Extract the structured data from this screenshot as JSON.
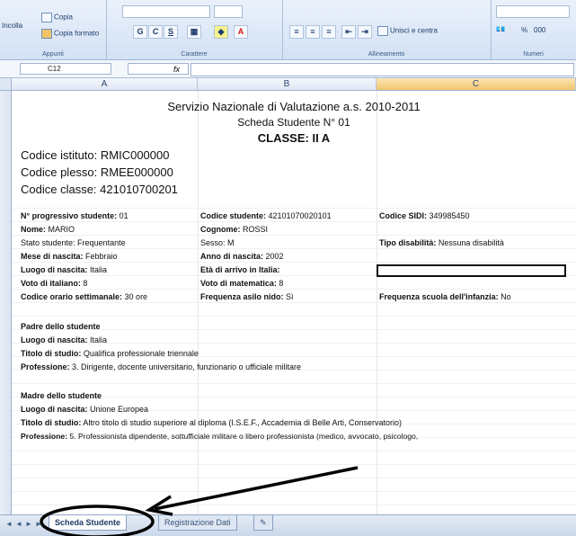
{
  "ribbon": {
    "clipboard": {
      "paste": "Incolla",
      "copy": "Copia",
      "format_painter": "Copia formato",
      "group": "Appunti"
    },
    "font": {
      "bold": "G",
      "italic": "C",
      "underline": "S",
      "group": "Carattere"
    },
    "alignment": {
      "merge": "Unisci e centra",
      "group": "Allineamento"
    },
    "number": {
      "percent": "%",
      "thousands": "000",
      "group": "Numeri"
    }
  },
  "formula_bar": {
    "name_box": "C12",
    "fx": "fx",
    "value": ""
  },
  "columns": [
    "A",
    "B",
    "C"
  ],
  "sheet": {
    "title": "Servizio Nazionale di Valutazione a.s. 2010-2011",
    "subtitle": "Scheda Studente N° 01",
    "class": "CLASSE: II A",
    "codes": [
      "Codice istituto: RMIC000000",
      "Codice plesso: RMEE000000",
      "Codice classe: 421010700201"
    ],
    "student_rows": [
      [
        {
          "k": "N° progressivo studente:",
          "v": " 01"
        },
        {
          "k": "Codice studente:",
          "v": " 42101070020101"
        },
        {
          "k": "Codice SIDI:",
          "v": " 349985450"
        }
      ],
      [
        {
          "k": "Nome:",
          "v": " MARIO"
        },
        {
          "k": "Cognome:",
          "v": " ROSSI"
        },
        {
          "k": "",
          "v": ""
        }
      ],
      [
        {
          "k": "",
          "v": "Stato studente: Frequentante"
        },
        {
          "k": "",
          "v": "Sesso: M"
        },
        {
          "k": "Tipo disabilità:",
          "v": " Nessuna disabilità"
        }
      ],
      [
        {
          "k": "Mese di nascita:",
          "v": " Febbraio"
        },
        {
          "k": "Anno di nascita:",
          "v": " 2002"
        },
        {
          "k": "",
          "v": ""
        }
      ],
      [
        {
          "k": "Luogo di nascita:",
          "v": " Italia"
        },
        {
          "k": "Età di arrivo in Italia:",
          "v": ""
        },
        {
          "k": "",
          "v": ""
        }
      ],
      [
        {
          "k": "Voto di italiano:",
          "v": " 8"
        },
        {
          "k": "Voto di matematica:",
          "v": " 8"
        },
        {
          "k": "",
          "v": ""
        }
      ],
      [
        {
          "k": "Codice orario settimanale:",
          "v": " 30 ore"
        },
        {
          "k": "Frequenza asilo nido:",
          "v": " Sì"
        },
        {
          "k": "Frequenza scuola dell'infanzia:",
          "v": " No"
        }
      ]
    ],
    "father": {
      "heading": "Padre dello studente",
      "birthplace_label": "Luogo di nascita:",
      "birthplace": " Italia",
      "study_label": "Titolo di studio:",
      "study": " Qualifica professionale triennale",
      "job_label": "Professione:",
      "job": " 3. Dirigente, docente universitario, funzionario o ufficiale militare"
    },
    "mother": {
      "heading": "Madre dello studente",
      "birthplace_label": "Luogo di nascita:",
      "birthplace": " Unione Europea",
      "study_label": "Titolo di studio:",
      "study": " Altro titolo di studio superiore al diploma (I.S.E.F., Accademia di Belle Arti, Conservatorio)",
      "job_label": "Professione:",
      "job": " 5. Professionista dipendente, sottufficiale militare o libero professionista (medico, avvocato, psicologo,"
    }
  },
  "tabs": [
    {
      "label": "Scheda Studente",
      "active": true
    },
    {
      "label": "Registrazione Dati",
      "active": false
    }
  ],
  "colors": {
    "ribbon": "#d3e1f4",
    "selected_header": "#f3c46b",
    "annotation": "#000000"
  }
}
